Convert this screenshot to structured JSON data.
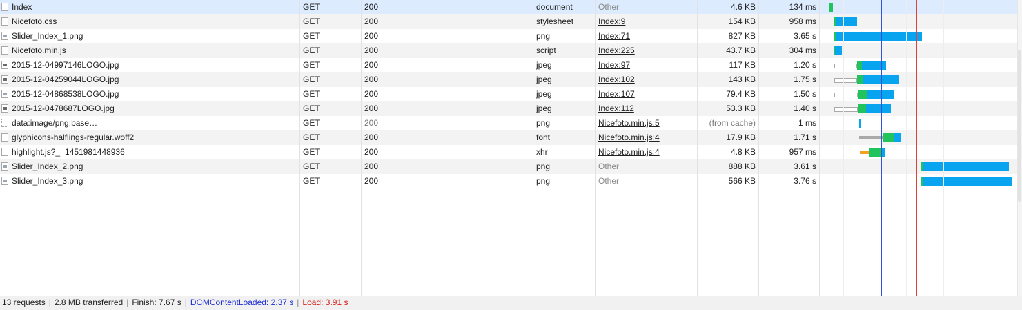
{
  "colors": {
    "selected_row": "#dcebfd",
    "alt_row": "#f3f3f3",
    "dom_content_loaded": "#3553d6",
    "load": "#e0403a",
    "bar_waiting": "#21c35c",
    "bar_receiving": "#08a4ef"
  },
  "requests": [
    {
      "name": "Index",
      "icon": "document-icon",
      "method": "GET",
      "status": "200",
      "type": "document",
      "initiator": "Other",
      "initiator_link": false,
      "size": "4.6 KB",
      "time": "134 ms",
      "selected": true,
      "timing": {
        "waiting": [
          1201,
          1203
        ],
        "green": [
          1203,
          1207
        ],
        "blue": null
      }
    },
    {
      "name": "Nicefoto.css",
      "icon": "document-icon",
      "method": "GET",
      "status": "200",
      "type": "stylesheet",
      "initiator": "Index:9",
      "initiator_link": true,
      "size": "154 KB",
      "time": "958 ms",
      "timing": {
        "green": [
          1209,
          1212
        ],
        "blue": [
          1212,
          1242
        ]
      }
    },
    {
      "name": "Slider_Index_1.png",
      "icon": "image-icon-light",
      "method": "GET",
      "status": "200",
      "type": "png",
      "initiator": "Index:71",
      "initiator_link": true,
      "size": "827 KB",
      "time": "3.65 s",
      "timing": {
        "green": [
          1209,
          1212
        ],
        "blue": [
          1212,
          1336
        ]
      }
    },
    {
      "name": "Nicefoto.min.js",
      "icon": "document-icon",
      "method": "GET",
      "status": "200",
      "type": "script",
      "initiator": "Index:225",
      "initiator_link": true,
      "size": "43.7 KB",
      "time": "304 ms",
      "timing": {
        "green": [
          1209,
          1210
        ],
        "blue": [
          1210,
          1220
        ]
      }
    },
    {
      "name": "2015-12-04997146LOGO.jpg",
      "icon": "image-icon",
      "method": "GET",
      "status": "200",
      "type": "jpeg",
      "initiator": "Index:97",
      "initiator_link": true,
      "size": "117 KB",
      "time": "1.20 s",
      "timing": {
        "hollow": [
          1209,
          1242
        ],
        "green": [
          1242,
          1249
        ],
        "blue": [
          1249,
          1284
        ]
      }
    },
    {
      "name": "2015-12-04259044LOGO.jpg",
      "icon": "image-icon",
      "method": "GET",
      "status": "200",
      "type": "jpeg",
      "initiator": "Index:102",
      "initiator_link": true,
      "size": "143 KB",
      "time": "1.75 s",
      "timing": {
        "hollow": [
          1209,
          1242
        ],
        "green": [
          1242,
          1251
        ],
        "blue": [
          1251,
          1303
        ]
      }
    },
    {
      "name": "2015-12-04868538LOGO.jpg",
      "icon": "image-icon-light",
      "method": "GET",
      "status": "200",
      "type": "jpeg",
      "initiator": "Index:107",
      "initiator_link": true,
      "size": "79.4 KB",
      "time": "1.50 s",
      "timing": {
        "hollow": [
          1209,
          1243
        ],
        "green": [
          1243,
          1256
        ],
        "blue": [
          1256,
          1295
        ]
      }
    },
    {
      "name": "2015-12-0478687LOGO.jpg",
      "icon": "image-icon",
      "method": "GET",
      "status": "200",
      "type": "jpeg",
      "initiator": "Index:112",
      "initiator_link": true,
      "size": "53.3 KB",
      "time": "1.40 s",
      "timing": {
        "hollow": [
          1209,
          1243
        ],
        "green": [
          1243,
          1255
        ],
        "blue": [
          1255,
          1291
        ]
      }
    },
    {
      "name": "data:image/png;base…",
      "icon": "data-uri-icon",
      "method": "GET",
      "status": "200",
      "status_muted": true,
      "type": "png",
      "initiator": "Nicefoto.min.js:5",
      "initiator_link": true,
      "size": "(from cache)",
      "size_muted": true,
      "time": "1 ms",
      "timing": {
        "blue": [
          1245,
          1248
        ]
      }
    },
    {
      "name": "glyphicons-halflings-regular.woff2",
      "icon": "document-icon",
      "method": "GET",
      "status": "200",
      "type": "font",
      "initiator": "Nicefoto.min.js:4",
      "initiator_link": true,
      "size": "17.9 KB",
      "time": "1.71 s",
      "timing": {
        "grey": [
          1245,
          1279
        ],
        "green": [
          1279,
          1296
        ],
        "blue": [
          1296,
          1305
        ]
      }
    },
    {
      "name": "highlight.js?_=1451981448936",
      "icon": "document-icon",
      "method": "GET",
      "status": "200",
      "type": "xhr",
      "initiator": "Nicefoto.min.js:4",
      "initiator_link": true,
      "size": "4.8 KB",
      "time": "957 ms",
      "timing": {
        "orange": [
          1246,
          1260
        ],
        "green": [
          1260,
          1276
        ],
        "blue": [
          1276,
          1282
        ]
      }
    },
    {
      "name": "Slider_Index_2.png",
      "icon": "image-icon-light",
      "method": "GET",
      "status": "200",
      "type": "png",
      "initiator": "Other",
      "initiator_link": false,
      "size": "888 KB",
      "time": "3.61 s",
      "timing": {
        "green": [
          1335,
          1337
        ],
        "blue": [
          1337,
          1462
        ]
      }
    },
    {
      "name": "Slider_Index_3.png",
      "icon": "image-icon-light",
      "method": "GET",
      "status": "200",
      "type": "png",
      "initiator": "Other",
      "initiator_link": false,
      "size": "566 KB",
      "time": "3.76 s",
      "timing": {
        "green": [
          1335,
          1337
        ],
        "blue": [
          1337,
          1467
        ]
      }
    }
  ],
  "footer": {
    "requests": "13 requests",
    "transferred": "2.8 MB transferred",
    "finish": "Finish: 7.67 s",
    "dom_content_loaded": "DOMContentLoaded: 2.37 s",
    "load": "Load: 3.91 s",
    "separator": "|"
  }
}
